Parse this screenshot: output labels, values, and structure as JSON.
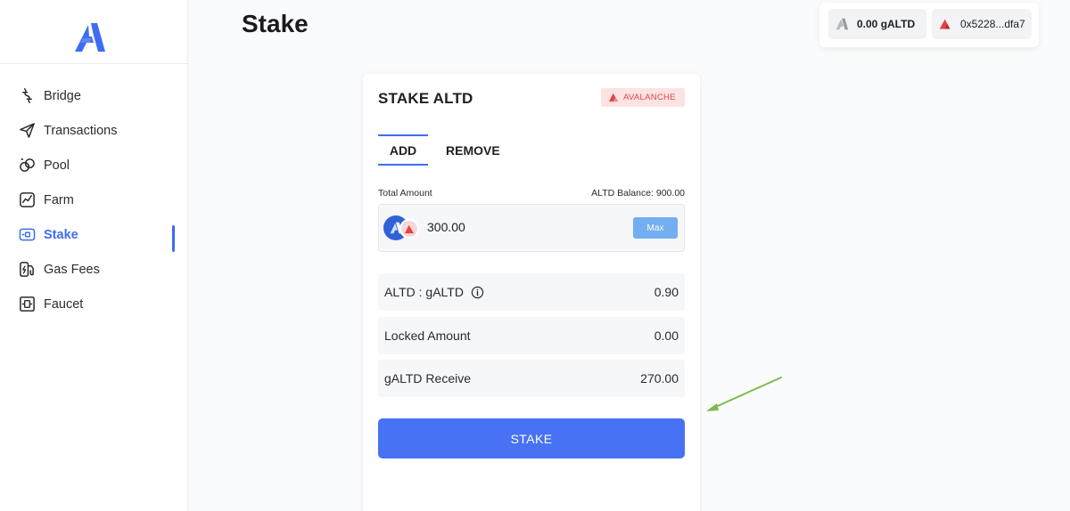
{
  "sidebar": {
    "logo_icon": "brand-logo-icon",
    "items": [
      {
        "label": "Bridge",
        "icon": "bridge-icon",
        "active": false
      },
      {
        "label": "Transactions",
        "icon": "send-icon",
        "active": false
      },
      {
        "label": "Pool",
        "icon": "pool-icon",
        "active": false
      },
      {
        "label": "Farm",
        "icon": "chart-icon",
        "active": false
      },
      {
        "label": "Stake",
        "icon": "stake-icon",
        "active": true
      },
      {
        "label": "Gas Fees",
        "icon": "gas-icon",
        "active": false
      },
      {
        "label": "Faucet",
        "icon": "faucet-icon",
        "active": false
      }
    ]
  },
  "page": {
    "title": "Stake"
  },
  "header": {
    "balance": "0.00 gALTD",
    "wallet": "0x5228...dfa7"
  },
  "card": {
    "title": "STAKE ALTD",
    "network": "AVALANCHE",
    "tabs": {
      "add": "ADD",
      "remove": "REMOVE"
    },
    "amount_label": "Total Amount",
    "balance_label": "ALTD Balance: 900.00",
    "amount_value": "300.00",
    "max_label": "Max",
    "rows": {
      "rate_label": "ALTD : gALTD",
      "rate_value": "0.90",
      "locked_label": "Locked Amount",
      "locked_value": "0.00",
      "receive_label": "gALTD Receive",
      "receive_value": "270.00"
    },
    "stake_button": "STAKE"
  },
  "colors": {
    "accent": "#3d6df2",
    "stake_button": "#4672f3",
    "max_button": "#73aef0",
    "network_badge_bg": "#fbe3e3",
    "network_badge_text": "#e0444a",
    "annotation_arrow": "#7cbc4a"
  }
}
